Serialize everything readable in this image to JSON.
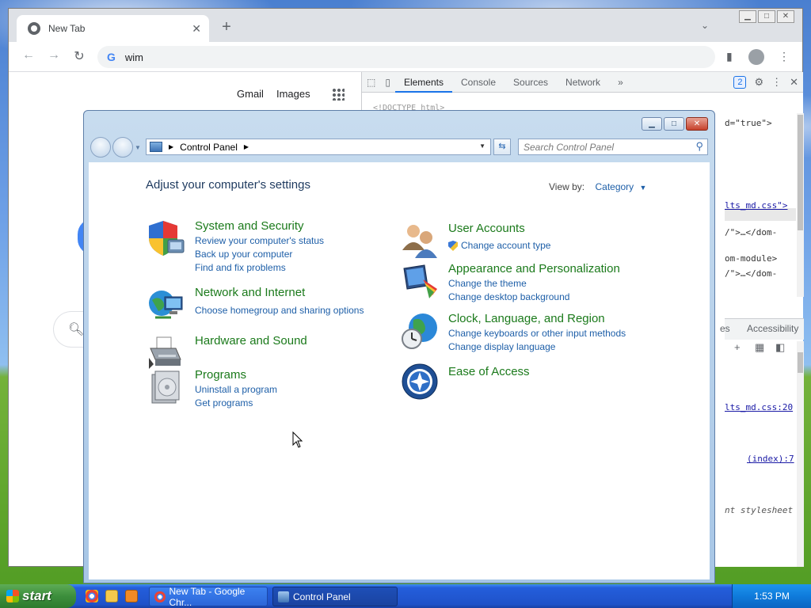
{
  "chrome": {
    "tab_title": "New Tab",
    "tab_close": "✕",
    "new_tab": "+",
    "omnibox_text": "wim",
    "nav": {
      "back": "←",
      "forward": "→",
      "reload": "↻"
    },
    "window_controls": {
      "minimize": "▁",
      "maximize": "□",
      "close": "✕"
    },
    "page_links": [
      "Gmail",
      "Images"
    ]
  },
  "devtools": {
    "tabs": [
      "Elements",
      "Console",
      "Sources",
      "Network"
    ],
    "more": "»",
    "issues_badge": "2",
    "doctype": "<!DOCTYPE html>",
    "code_lines": [
      {
        "text": "d=\"true\">",
        "style": ""
      },
      {
        "text": "lts_md.css\">",
        "style": "link"
      },
      {
        "text": "/\">…</dom-",
        "style": ""
      },
      {
        "text": "om-module>",
        "style": ""
      },
      {
        "text": "/\">…</dom-",
        "style": ""
      }
    ],
    "subtab_label": "Accessibility",
    "subtab_partial": "es",
    "styles_lines": [
      {
        "text": "lts_md.css:20",
        "style": "link"
      },
      {
        "text": "(index):7",
        "style": "link"
      },
      {
        "text": "nt stylesheet",
        "style": "italic"
      }
    ]
  },
  "control_panel": {
    "address": "Control Panel",
    "search_placeholder": "Search Control Panel",
    "heading": "Adjust your computer's settings",
    "view_by_label": "View by:",
    "view_by_value": "Category",
    "categories": [
      {
        "title": "System and Security",
        "links": [
          "Review your computer's status",
          "Back up your computer",
          "Find and fix problems"
        ],
        "icon": "shield-icon"
      },
      {
        "title": "Network and Internet",
        "links": [
          "Choose homegroup and sharing options"
        ],
        "icon": "network-globe-icon"
      },
      {
        "title": "Hardware and Sound",
        "links": [],
        "icon": "printer-icon"
      },
      {
        "title": "Programs",
        "links": [
          "Uninstall a program",
          "Get programs"
        ],
        "icon": "programs-disc-icon"
      },
      {
        "title": "User Accounts",
        "links": [
          "Change account type"
        ],
        "icon": "users-icon"
      },
      {
        "title": "Appearance and Personalization",
        "links": [
          "Change the theme",
          "Change desktop background"
        ],
        "icon": "monitor-paint-icon"
      },
      {
        "title": "Clock, Language, and Region",
        "links": [
          "Change keyboards or other input methods",
          "Change display language"
        ],
        "icon": "clock-globe-icon"
      },
      {
        "title": "Ease of Access",
        "links": [],
        "icon": "ease-of-access-icon"
      }
    ]
  },
  "taskbar": {
    "start": "start",
    "tasks": [
      "New Tab - Google Chr...",
      "Control Panel"
    ],
    "clock": "1:53 PM"
  },
  "colors": {
    "cp_category_green": "#1b7a1b",
    "cp_link_blue": "#1e5fa8",
    "xp_taskbar_blue": "#245edb",
    "chrome_accent": "#1a73e8"
  }
}
